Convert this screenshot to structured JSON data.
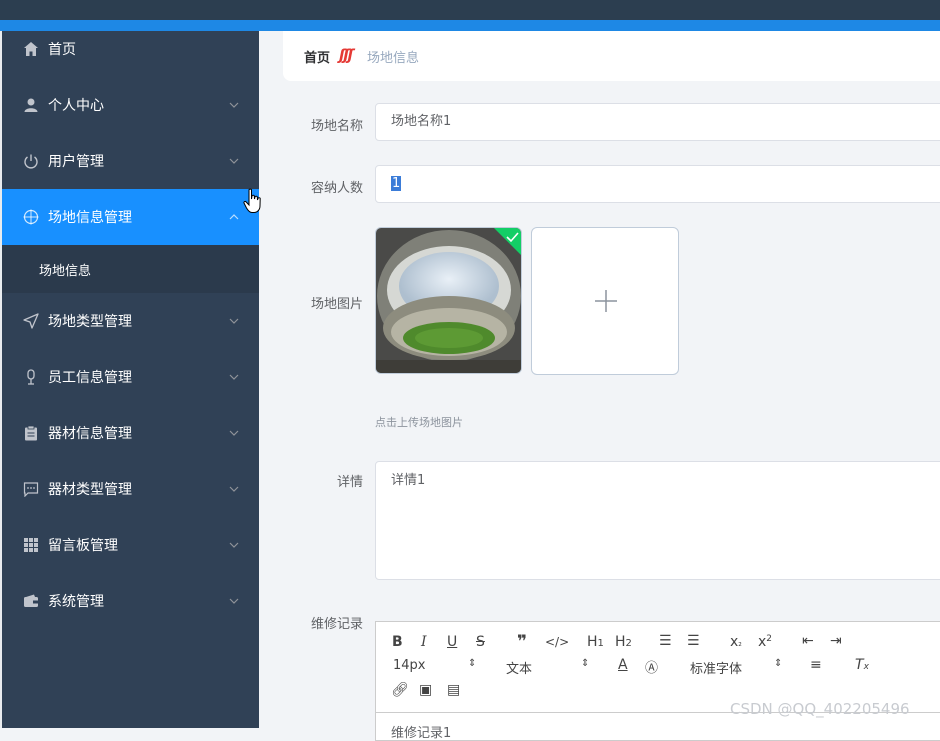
{
  "sidebar": {
    "items": [
      {
        "label": "首页",
        "icon": "home-icon",
        "expandable": false
      },
      {
        "label": "个人中心",
        "icon": "user-icon",
        "expandable": true
      },
      {
        "label": "用户管理",
        "icon": "power-icon",
        "expandable": true
      },
      {
        "label": "场地信息管理",
        "icon": "compass-icon",
        "expandable": true,
        "active": true
      },
      {
        "label": "场地类型管理",
        "icon": "send-icon",
        "expandable": true
      },
      {
        "label": "员工信息管理",
        "icon": "microphone-icon",
        "expandable": true
      },
      {
        "label": "器材信息管理",
        "icon": "clipboard-icon",
        "expandable": true
      },
      {
        "label": "器材类型管理",
        "icon": "chat-icon",
        "expandable": true
      },
      {
        "label": "留言板管理",
        "icon": "grid-icon",
        "expandable": true
      },
      {
        "label": "系统管理",
        "icon": "wallet-icon",
        "expandable": true
      }
    ],
    "submenu": {
      "label": "场地信息"
    },
    "active_color": "#1890ff",
    "bg_color": "#304156"
  },
  "breadcrumb": {
    "home": "首页",
    "separator": "ʃʃʃ",
    "current": "场地信息"
  },
  "form": {
    "name_label": "场地名称",
    "name_value": "场地名称1",
    "capacity_label": "容纳人数",
    "capacity_value": "1",
    "image_label": "场地图片",
    "upload_hint": "点击上传场地图片",
    "detail_label": "详情",
    "detail_value": "详情1",
    "maintenance_label": "维修记录",
    "maintenance_value": "维修记录1"
  },
  "editor_toolbar": {
    "font_size": "14px",
    "paragraph": "文本",
    "font_family": "标准字体"
  },
  "watermark": "CSDN @QQ_402205496"
}
